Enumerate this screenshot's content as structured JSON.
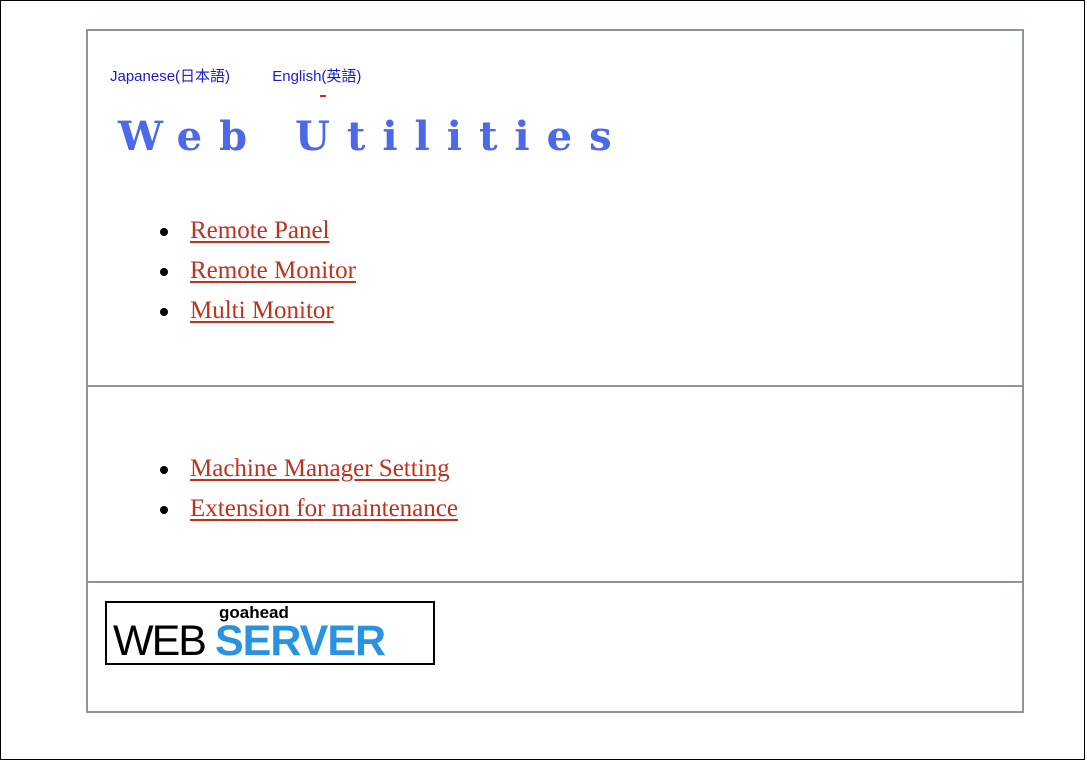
{
  "language_links": [
    {
      "label": "Japanese(日本語)"
    },
    {
      "label": "English(英語)"
    }
  ],
  "title": "Web Utilities",
  "utilities": [
    {
      "label": "Remote Panel"
    },
    {
      "label": "Remote Monitor"
    },
    {
      "label": "Multi Monitor"
    }
  ],
  "settings": [
    {
      "label": "Machine Manager Setting"
    },
    {
      "label": "Extension for maintenance"
    }
  ],
  "logo": {
    "small": "goahead",
    "web": "WEB",
    "server": "SERVER"
  },
  "colors": {
    "title": "#4d68e8",
    "link": "#c0301c",
    "lang_link": "#1a1ad0",
    "border": "#8a969c",
    "logo_server": "#2a93e0"
  }
}
